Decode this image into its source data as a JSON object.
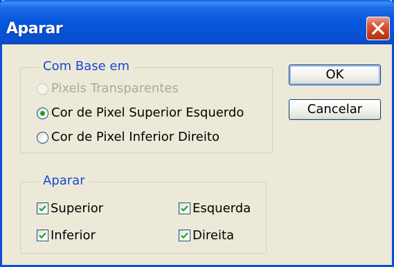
{
  "window": {
    "title": "Aparar",
    "close_label": "Fechar"
  },
  "based_on_group": {
    "legend": "Com Base em",
    "options": [
      {
        "label": "Pixels Transparentes",
        "selected": false,
        "enabled": false
      },
      {
        "label": "Cor de Pixel Superior Esquerdo",
        "selected": true,
        "enabled": true
      },
      {
        "label": "Cor de Pixel Inferior Direito",
        "selected": false,
        "enabled": true
      }
    ]
  },
  "trim_group": {
    "legend": "Aparar",
    "options": [
      {
        "label": "Superior",
        "checked": true
      },
      {
        "label": "Inferior",
        "checked": true
      },
      {
        "label": "Esquerda",
        "checked": true
      },
      {
        "label": "Direita",
        "checked": true
      }
    ]
  },
  "buttons": {
    "ok_label": "OK",
    "cancel_label": "Cancelar"
  },
  "colors": {
    "titlebar": "#0a4fd6",
    "legend_text": "#1846d4",
    "radio_dot": "#21a121",
    "check_mark": "#21a121",
    "dialog_bg": "#ece9d8"
  }
}
